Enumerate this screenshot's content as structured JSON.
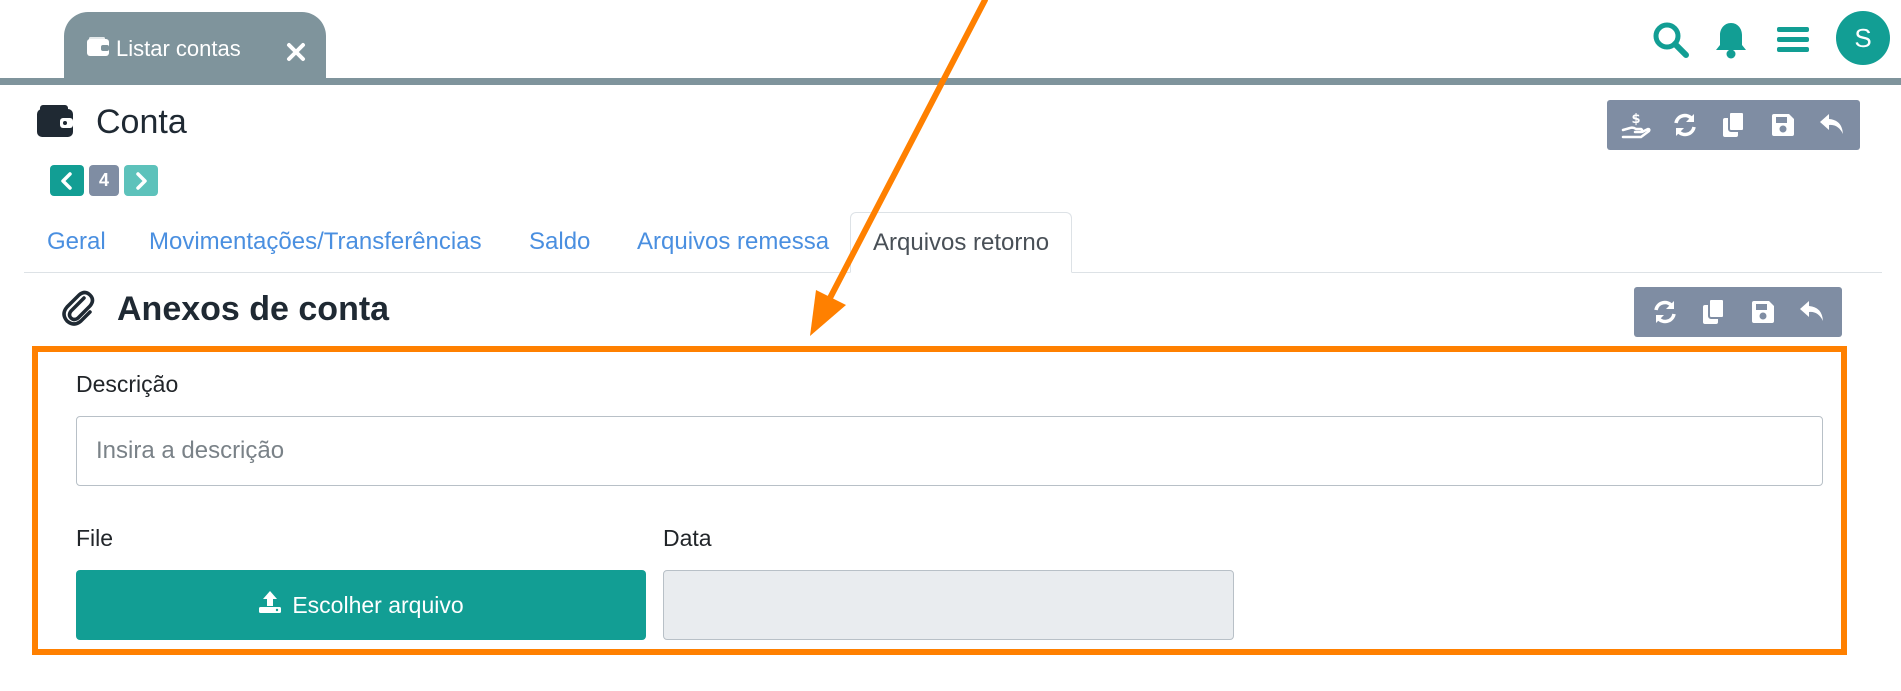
{
  "tab": {
    "label": "Listar contas"
  },
  "header": {
    "avatar_initial": "S"
  },
  "page": {
    "title": "Conta",
    "record_number": "4"
  },
  "nav_tabs": [
    {
      "label": "Geral"
    },
    {
      "label": "Movimentações/Transferências"
    },
    {
      "label": "Saldo"
    },
    {
      "label": "Arquivos remessa"
    },
    {
      "label": "Arquivos retorno"
    }
  ],
  "section": {
    "title": "Anexos de conta"
  },
  "form": {
    "description_label": "Descrição",
    "description_placeholder": "Insira a descrição",
    "description_value": "",
    "file_label": "File",
    "file_button": "Escolher arquivo",
    "date_label": "Data",
    "date_value": ""
  },
  "colors": {
    "accent": "#129e94",
    "tab_bg": "#7f949c",
    "toolbar_bg": "#7f8da3",
    "link": "#4a8fe0",
    "highlight": "#ff8000"
  },
  "icons": {
    "tab": "wallet-icon",
    "close": "close-icon",
    "search": "search-icon",
    "notifications": "bell-icon",
    "menu": "hamburger-menu-icon",
    "title": "wallet-icon",
    "section": "paperclip-icon",
    "toolbar": [
      "hand-dollar-icon",
      "refresh-icon",
      "copy-icon",
      "save-icon",
      "undo-icon"
    ],
    "section_toolbar": [
      "refresh-icon",
      "copy-icon",
      "save-icon",
      "undo-icon"
    ],
    "upload": "upload-icon"
  }
}
